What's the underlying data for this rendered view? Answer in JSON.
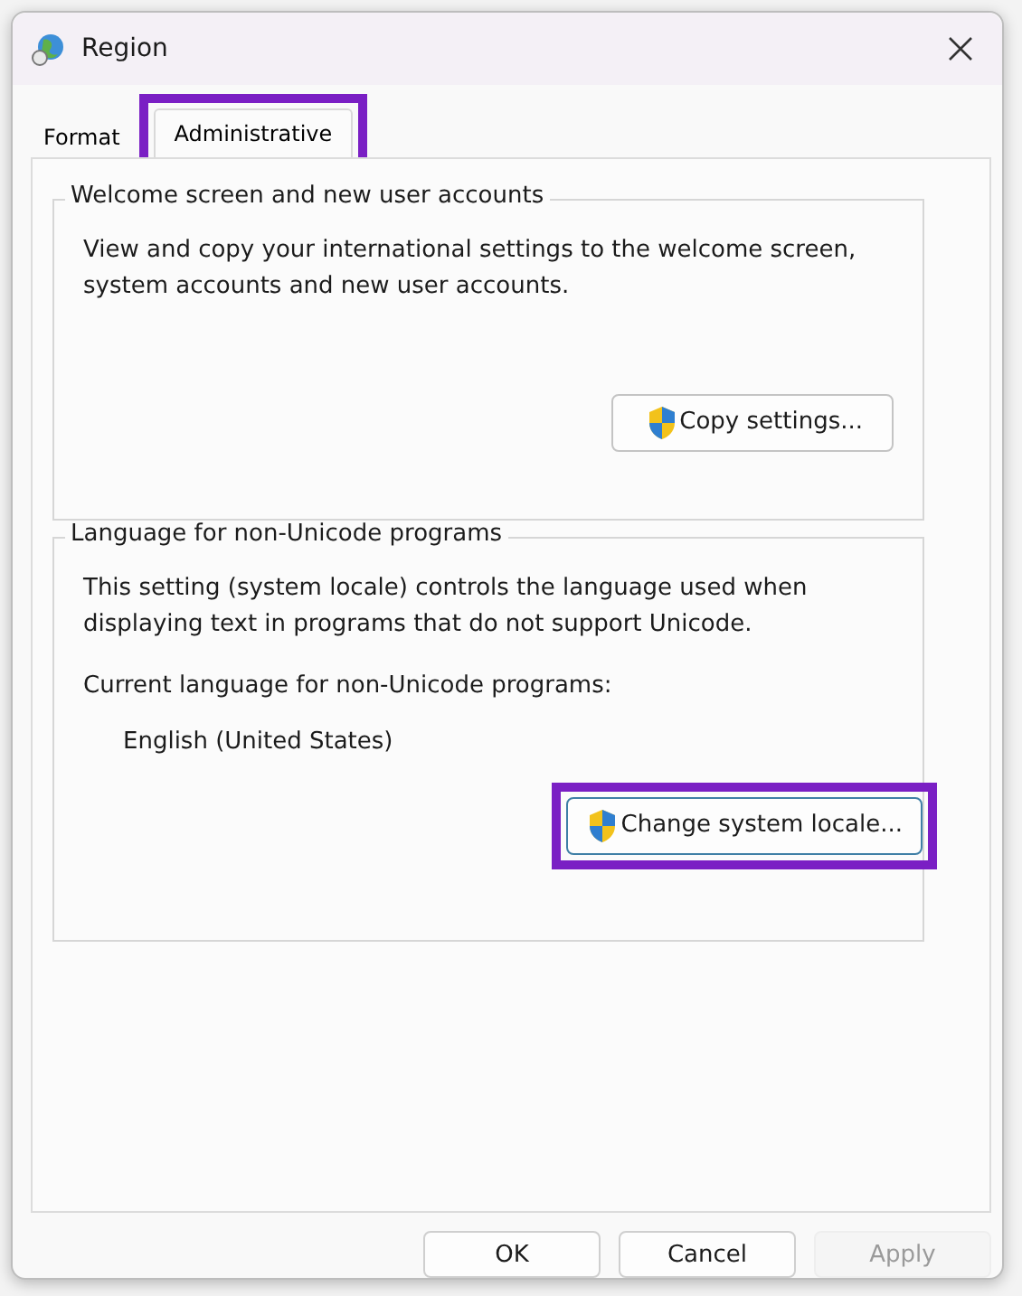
{
  "window": {
    "title": "Region"
  },
  "tabs": [
    {
      "label": "Format",
      "selected": false,
      "highlighted": false
    },
    {
      "label": "Administrative",
      "selected": true,
      "highlighted": true
    }
  ],
  "groups": [
    {
      "title": "Welcome screen and new user accounts",
      "text": "View and copy your international settings to the welcome screen, system accounts and new user accounts.",
      "button": {
        "label": "Copy settings...",
        "highlighted": false
      }
    },
    {
      "title": "Language for non-Unicode programs",
      "text": "This setting (system locale) controls the language used when displaying text in programs that do not support Unicode.",
      "current_label": "Current language for non-Unicode programs:",
      "current_value": "English (United States)",
      "button": {
        "label": "Change system locale...",
        "highlighted": true
      }
    }
  ],
  "buttons": [
    {
      "label": "OK",
      "disabled": false
    },
    {
      "label": "Cancel",
      "disabled": false
    },
    {
      "label": "Apply",
      "disabled": true
    }
  ]
}
